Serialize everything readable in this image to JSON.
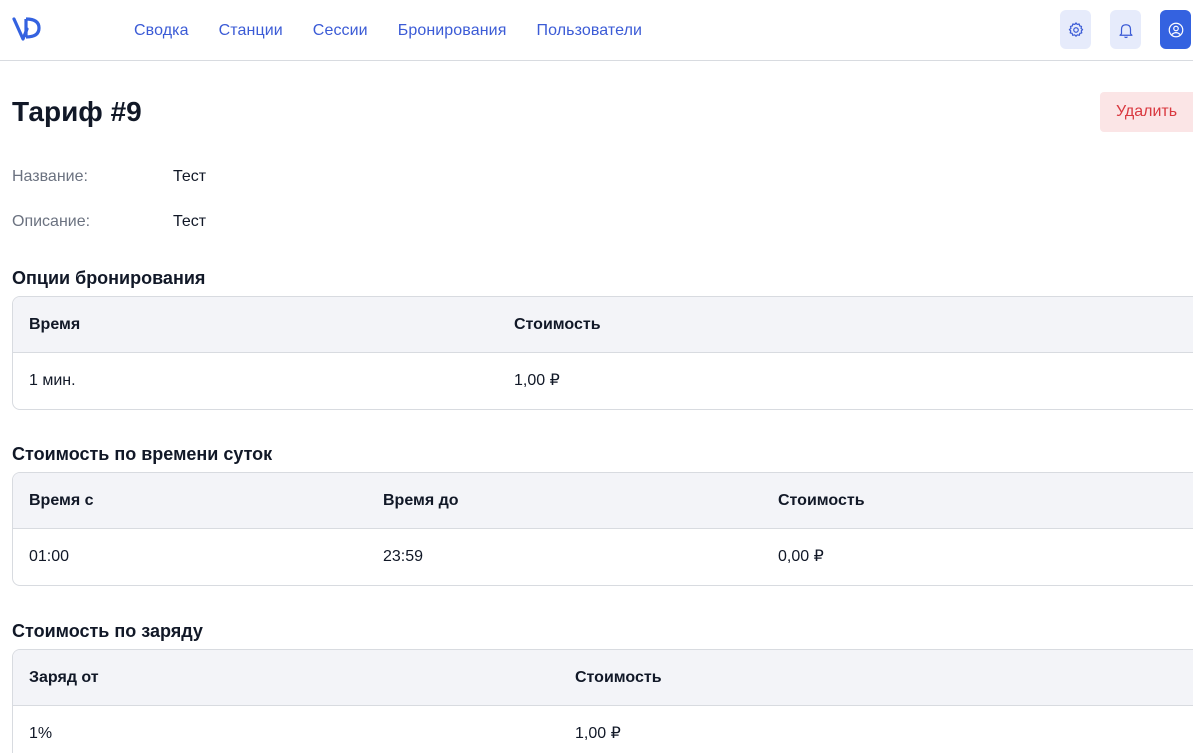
{
  "nav": {
    "items": [
      "Сводка",
      "Станции",
      "Сессии",
      "Бронирования",
      "Пользователи"
    ]
  },
  "header_icons": [
    "gear-icon",
    "bell-icon",
    "user-icon"
  ],
  "colors": {
    "accent": "#3462e0",
    "nav_link": "#3b5bd6",
    "danger_text": "#d9383f",
    "danger_bg": "#fbe5e6"
  },
  "page": {
    "title": "Тариф #9",
    "delete_label": "Удалить"
  },
  "fields": {
    "name_label": "Название:",
    "name_value": "Тест",
    "description_label": "Описание:",
    "description_value": "Тест"
  },
  "booking": {
    "title": "Опции бронирования",
    "headers": [
      "Время",
      "Стоимость"
    ],
    "rows": [
      [
        "1 мин.",
        "1,00 ₽"
      ]
    ]
  },
  "time_of_day": {
    "title": "Стоимость по времени суток",
    "headers": [
      "Время с",
      "Время до",
      "Стоимость"
    ],
    "rows": [
      [
        "01:00",
        "23:59",
        "0,00 ₽"
      ]
    ]
  },
  "charge": {
    "title": "Стоимость по заряду",
    "headers": [
      "Заряд от",
      "Стоимость"
    ],
    "rows": [
      [
        "1%",
        "1,00 ₽"
      ]
    ]
  }
}
